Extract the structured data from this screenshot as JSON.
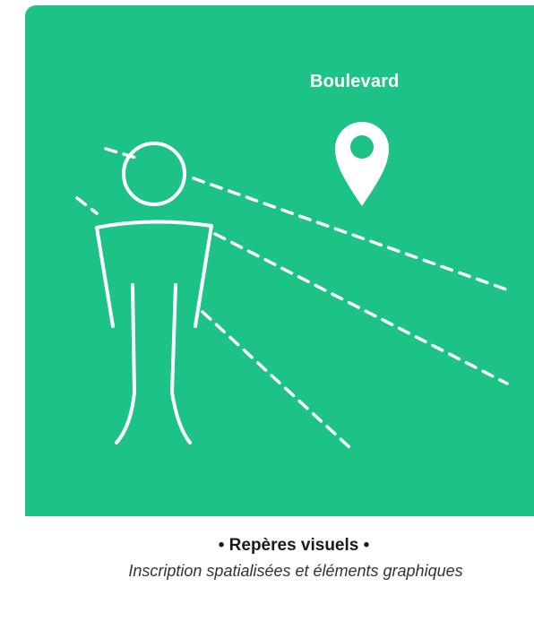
{
  "illustration": {
    "background_color": "#1dc287",
    "line_color": "#ffffff",
    "place_label": "Boulevard",
    "icons": [
      "person-icon",
      "map-pin-icon"
    ]
  },
  "caption": {
    "title": "• Repères visuels •",
    "subtitle": "Inscription spatialisées et éléments graphiques"
  }
}
